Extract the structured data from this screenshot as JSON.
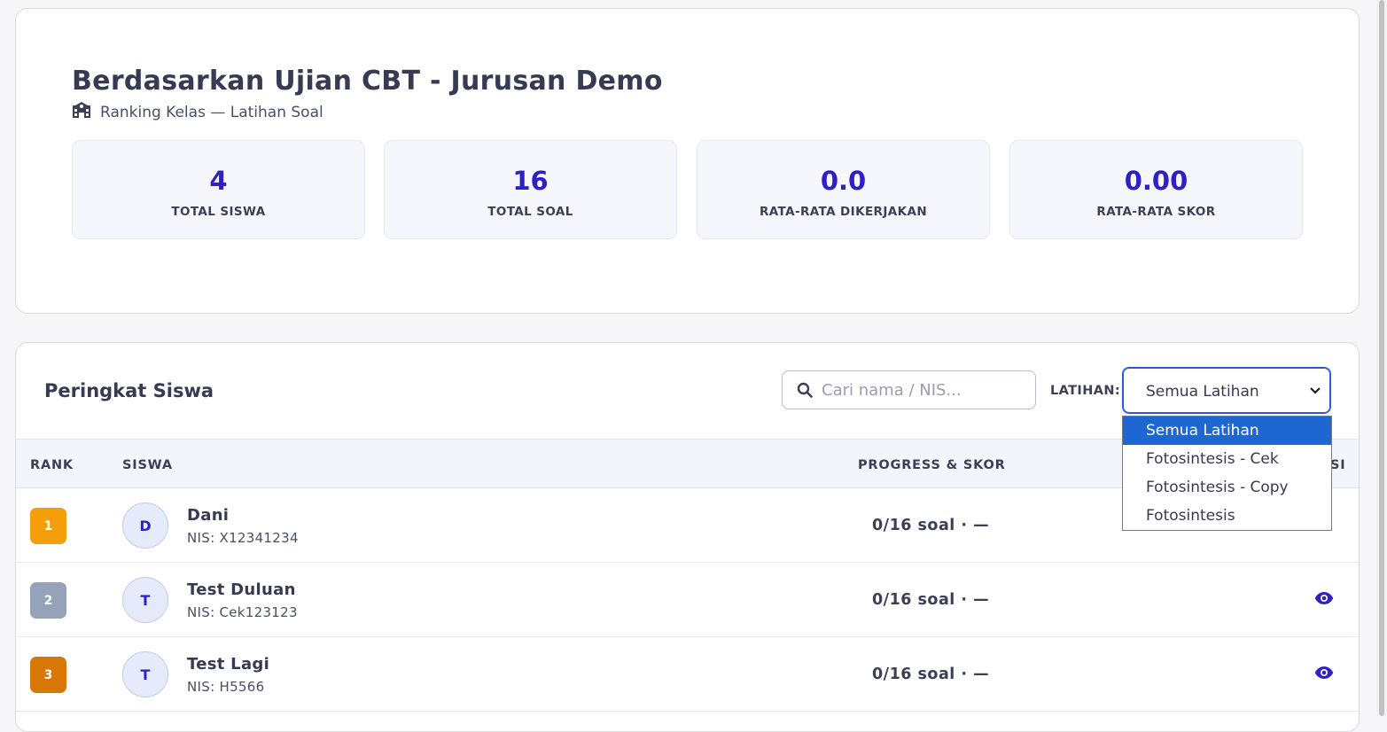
{
  "summary": {
    "title": "Berdasarkan Ujian CBT - Jurusan Demo",
    "subtitle": "Ranking Kelas — Latihan Soal",
    "stats": [
      {
        "value": "4",
        "label": "TOTAL SISWA"
      },
      {
        "value": "16",
        "label": "TOTAL SOAL"
      },
      {
        "value": "0.0",
        "label": "RATA-RATA DIKERJAKAN"
      },
      {
        "value": "0.00",
        "label": "RATA-RATA SKOR"
      }
    ]
  },
  "ranking": {
    "title": "Peringkat Siswa",
    "search": {
      "placeholder": "Cari nama / NIS...",
      "value": ""
    },
    "filter_label": "LATIHAN:",
    "filter_selected": "Semua Latihan",
    "filter_options": [
      "Semua Latihan",
      "Fotosintesis - Cek",
      "Fotosintesis - Copy",
      "Fotosintesis"
    ],
    "columns": {
      "rank": "RANK",
      "student": "SISWA",
      "progress": "PROGRESS & SKOR",
      "action": "SI"
    },
    "rows": [
      {
        "rank": "1",
        "initial": "D",
        "name": "Dani",
        "nis": "NIS: X12341234",
        "progress": "0/16 soal · —",
        "badge_color": "#f59e0b"
      },
      {
        "rank": "2",
        "initial": "T",
        "name": "Test Duluan",
        "nis": "NIS: Cek123123",
        "progress": "0/16 soal · —",
        "badge_color": "#94a3b8"
      },
      {
        "rank": "3",
        "initial": "T",
        "name": "Test Lagi",
        "nis": "NIS: H5566",
        "progress": "0/16 soal · —",
        "badge_color": "#d97706"
      }
    ]
  },
  "colors": {
    "accent": "#2f1fc6",
    "selected_option": "#1e67d3"
  },
  "icons": {
    "subtitle": "school-icon",
    "search": "search-icon",
    "view": "eye-icon",
    "select": "chevron-down-icon"
  }
}
